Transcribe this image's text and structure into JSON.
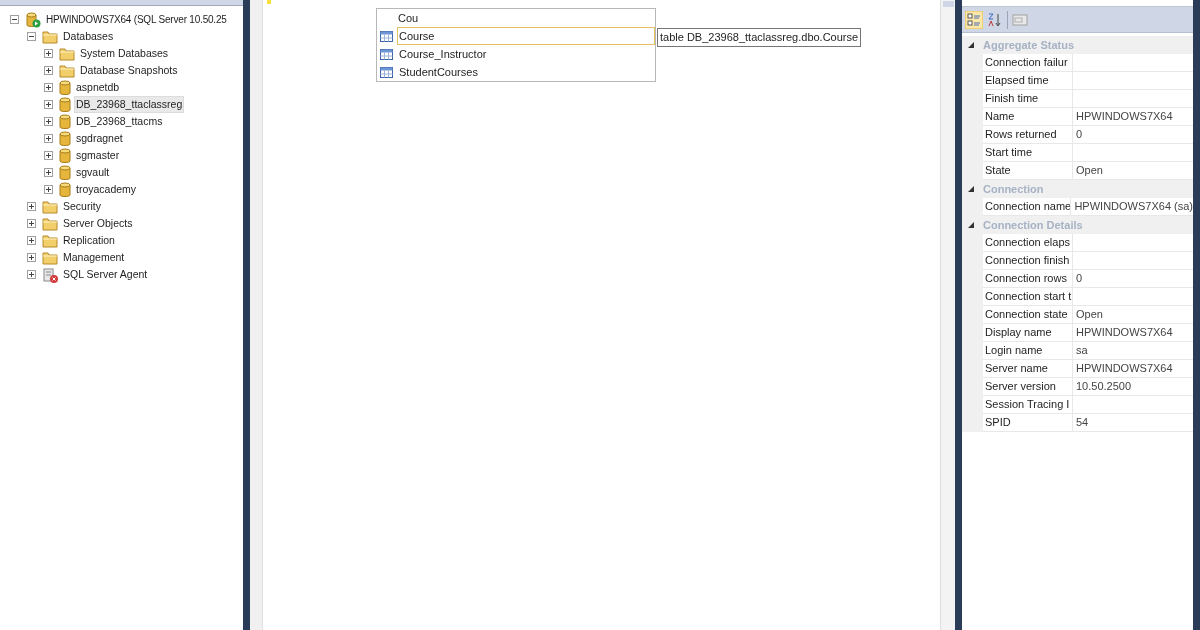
{
  "object_explorer": {
    "tree": [
      {
        "label": "HPWINDOWS7X64 (SQL Server 10.50.25",
        "kind": "server",
        "expanded": true,
        "selected": false,
        "children": [
          {
            "label": "Databases",
            "kind": "folder",
            "expanded": true,
            "selected": false,
            "children": [
              {
                "label": "System Databases",
                "kind": "folder",
                "expanded": false,
                "selected": false
              },
              {
                "label": "Database Snapshots",
                "kind": "folder",
                "expanded": false,
                "selected": false
              },
              {
                "label": "aspnetdb",
                "kind": "database",
                "expanded": false,
                "selected": false
              },
              {
                "label": "DB_23968_ttaclassreg",
                "kind": "database",
                "expanded": false,
                "selected": true
              },
              {
                "label": "DB_23968_ttacms",
                "kind": "database",
                "expanded": false,
                "selected": false
              },
              {
                "label": "sgdragnet",
                "kind": "database",
                "expanded": false,
                "selected": false
              },
              {
                "label": "sgmaster",
                "kind": "database",
                "expanded": false,
                "selected": false
              },
              {
                "label": "sgvault",
                "kind": "database",
                "expanded": false,
                "selected": false
              },
              {
                "label": "troyacademy",
                "kind": "database",
                "expanded": false,
                "selected": false
              }
            ]
          },
          {
            "label": "Security",
            "kind": "folder",
            "expanded": false,
            "selected": false
          },
          {
            "label": "Server Objects",
            "kind": "folder",
            "expanded": false,
            "selected": false
          },
          {
            "label": "Replication",
            "kind": "folder",
            "expanded": false,
            "selected": false
          },
          {
            "label": "Management",
            "kind": "folder",
            "expanded": false,
            "selected": false
          },
          {
            "label": "SQL Server Agent",
            "kind": "agent",
            "expanded": false,
            "selected": false
          }
        ]
      }
    ]
  },
  "editor": {
    "completion": {
      "typed": "Cou",
      "items": [
        {
          "label": "Course",
          "selected": true
        },
        {
          "label": "Course_Instructor",
          "selected": false
        },
        {
          "label": "StudentCourses",
          "selected": false
        }
      ],
      "tooltip": "table DB_23968_ttaclassreg.dbo.Course"
    }
  },
  "properties": {
    "categories": [
      {
        "name": "Aggregate Status",
        "rows": [
          {
            "name": "Connection failur",
            "value": ""
          },
          {
            "name": "Elapsed time",
            "value": ""
          },
          {
            "name": "Finish time",
            "value": ""
          },
          {
            "name": "Name",
            "value": "HPWINDOWS7X64"
          },
          {
            "name": "Rows returned",
            "value": "0"
          },
          {
            "name": "Start time",
            "value": ""
          },
          {
            "name": "State",
            "value": "Open"
          }
        ]
      },
      {
        "name": "Connection",
        "rows": [
          {
            "name": "Connection name",
            "value": "HPWINDOWS7X64 (sa)"
          }
        ]
      },
      {
        "name": "Connection Details",
        "rows": [
          {
            "name": "Connection elaps",
            "value": ""
          },
          {
            "name": "Connection finish",
            "value": ""
          },
          {
            "name": "Connection rows",
            "value": "0"
          },
          {
            "name": "Connection start t",
            "value": ""
          },
          {
            "name": "Connection state",
            "value": "Open"
          },
          {
            "name": "Display name",
            "value": "HPWINDOWS7X64"
          },
          {
            "name": "Login name",
            "value": "sa"
          },
          {
            "name": "Server name",
            "value": "HPWINDOWS7X64"
          },
          {
            "name": "Server version",
            "value": "10.50.2500"
          },
          {
            "name": "Session Tracing I",
            "value": ""
          },
          {
            "name": "SPID",
            "value": "54"
          }
        ]
      }
    ]
  }
}
